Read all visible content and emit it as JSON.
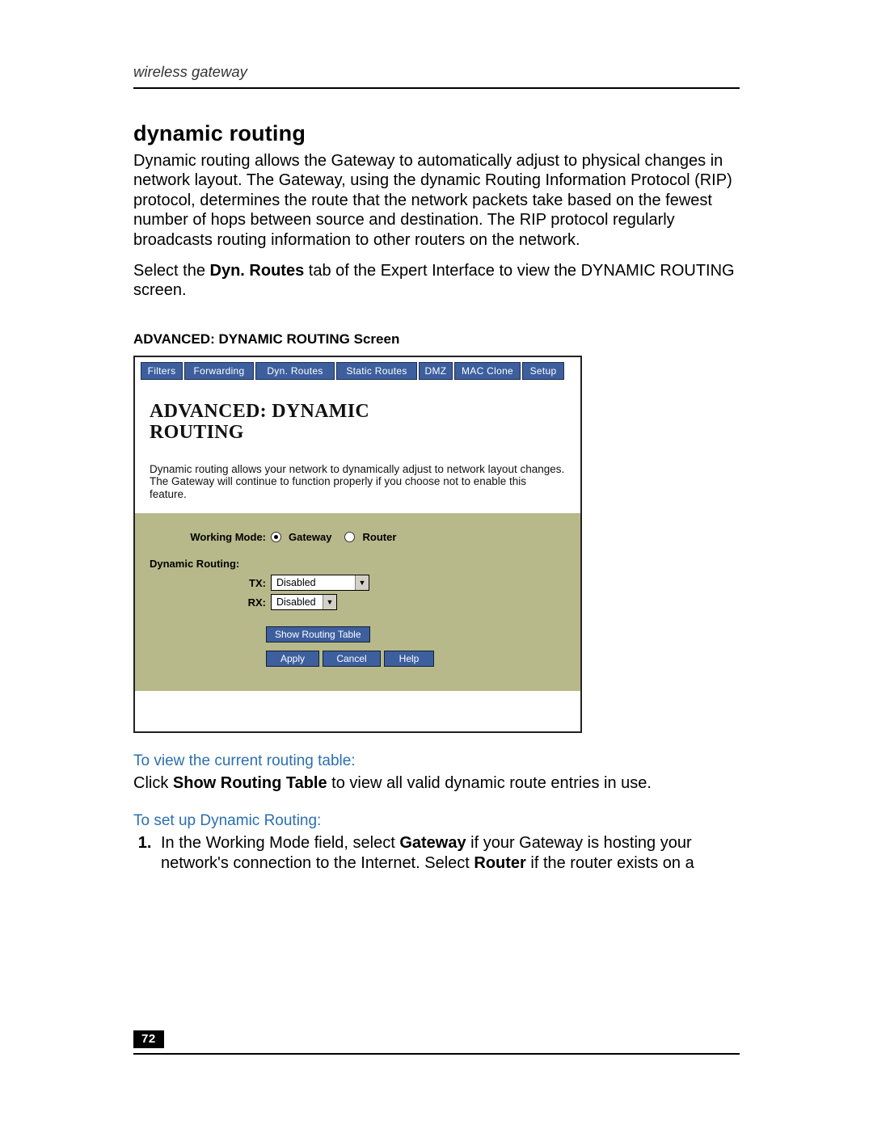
{
  "header": {
    "running": "wireless gateway"
  },
  "section": {
    "title": "dynamic routing",
    "intro": "Dynamic routing allows the Gateway to automatically adjust to physical changes in network layout. The Gateway, using the dynamic Routing Information Protocol (RIP) protocol, determines the route that the network packets take based on the fewest number of hops between source and destination. The RIP protocol regularly broadcasts routing information to other routers on the network.",
    "select_pre": "Select the ",
    "select_bold": "Dyn. Routes",
    "select_post": " tab of the Expert Interface to view the DYNAMIC ROUTING screen.",
    "caption": "ADVANCED: DYNAMIC ROUTING Screen"
  },
  "screenshot": {
    "tabs": [
      "Filters",
      "Forwarding",
      "Dyn. Routes",
      "Static Routes",
      "DMZ",
      "MAC Clone",
      "Setup"
    ],
    "heading_line1": "ADVANCED: DYNAMIC",
    "heading_line2": "ROUTING",
    "description": "Dynamic routing allows your network to dynamically adjust to network layout changes. The Gateway will continue to function properly if you choose not to enable this feature.",
    "form": {
      "working_mode_label": "Working Mode:",
      "radio_gateway": "Gateway",
      "radio_router": "Router",
      "dyn_routing_label": "Dynamic Routing:",
      "tx_label": "TX:",
      "tx_value": "Disabled",
      "rx_label": "RX:",
      "rx_value": "Disabled",
      "show_table_btn": "Show Routing Table",
      "apply_btn": "Apply",
      "cancel_btn": "Cancel",
      "help_btn": "Help"
    }
  },
  "after": {
    "sub1": "To view the current routing table:",
    "click_pre": "Click ",
    "click_bold": "Show Routing Table",
    "click_post": " to view all valid dynamic route entries in use.",
    "sub2": "To set up Dynamic Routing:",
    "step1_pre": "In the Working Mode field, select ",
    "step1_b1": "Gateway",
    "step1_mid": " if your Gateway is hosting your network's connection to the Internet. Select ",
    "step1_b2": "Router",
    "step1_post": " if the router exists on a"
  },
  "footer": {
    "page_number": "72"
  }
}
